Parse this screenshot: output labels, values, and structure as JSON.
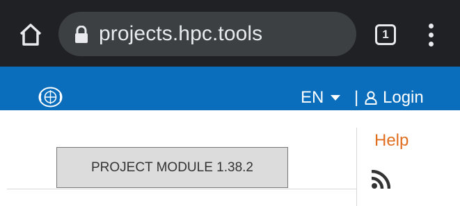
{
  "browser": {
    "url": "projects.hpc.tools",
    "tab_count": "1",
    "icons": [
      "home-icon",
      "lock-icon",
      "tab-switcher-icon",
      "more-vert-icon"
    ]
  },
  "header": {
    "background": "#0a6ebd",
    "language": "EN",
    "separator": "|",
    "login_label": "Login",
    "icons": [
      "un-emblem-icon",
      "caret-down-icon",
      "user-icon"
    ]
  },
  "content": {
    "module_button_label": "PROJECT MODULE 1.38.2",
    "help_label": "Help",
    "help_color": "#e06e1e",
    "icons": [
      "rss-icon"
    ]
  }
}
